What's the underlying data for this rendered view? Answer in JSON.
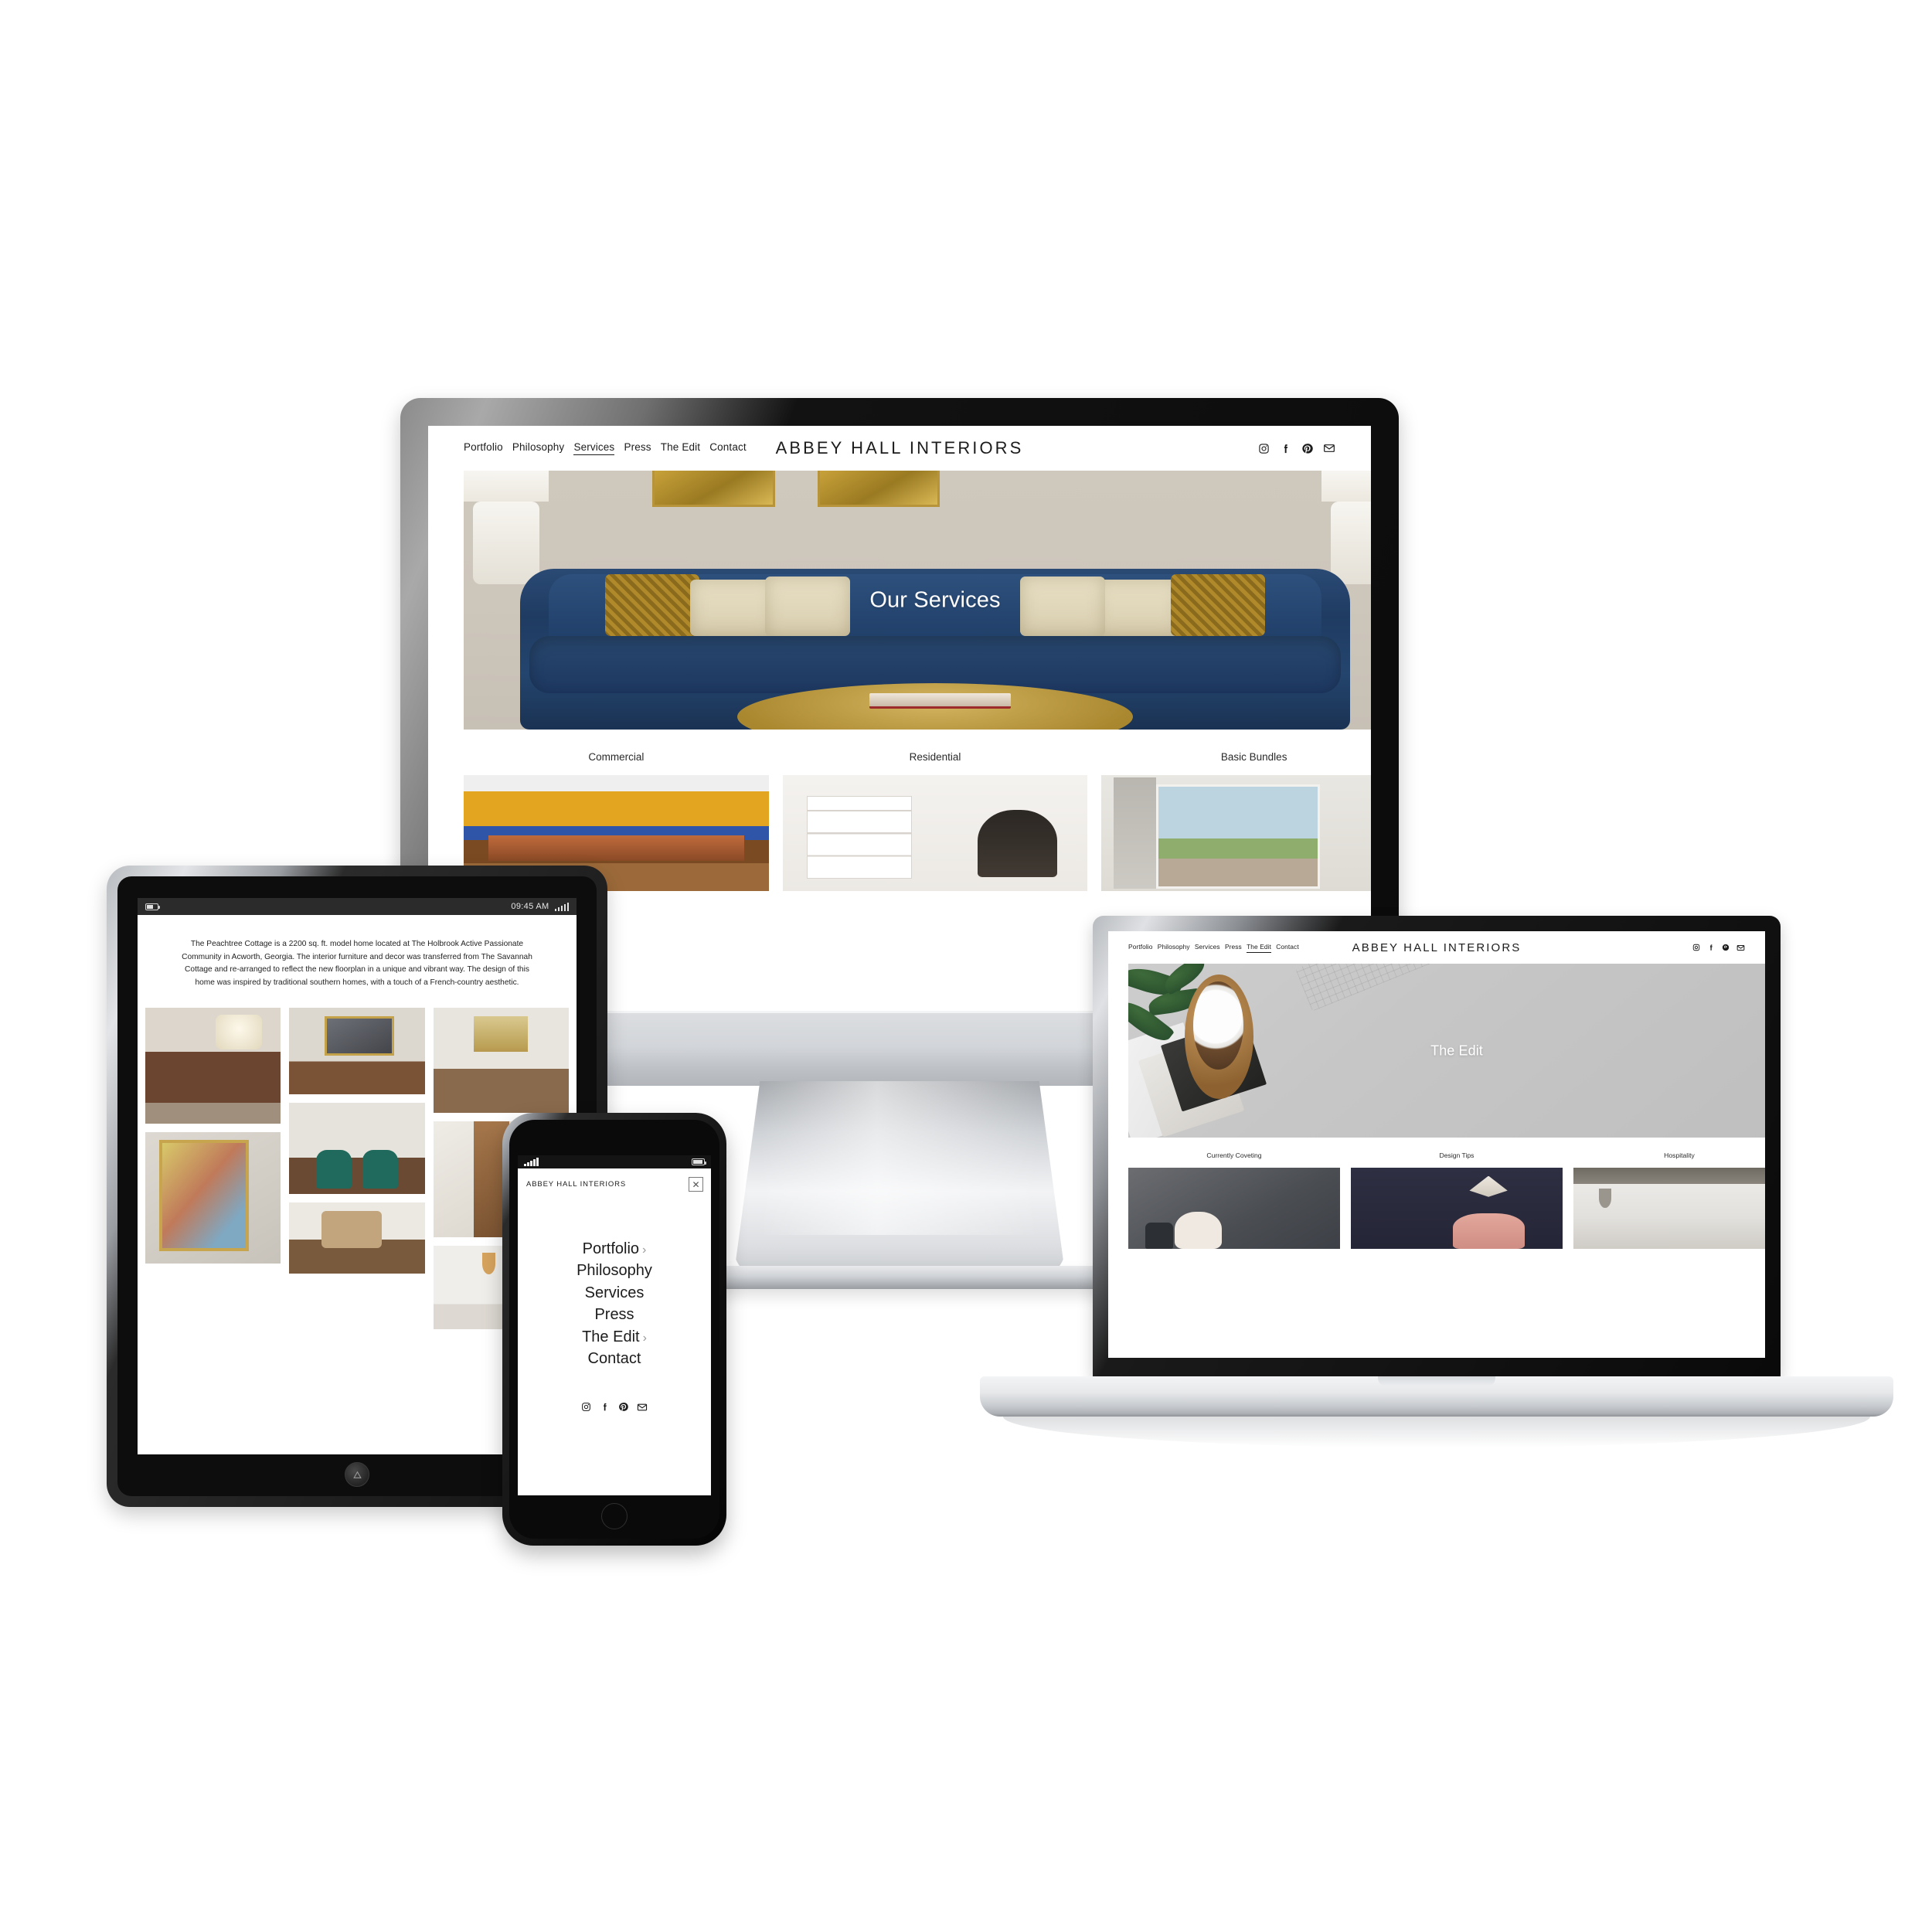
{
  "brand": "ABBEY HALL INTERIORS",
  "nav_items": [
    "Portfolio",
    "Philosophy",
    "Services",
    "Press",
    "The Edit",
    "Contact"
  ],
  "social_icons": [
    "instagram-icon",
    "facebook-icon",
    "pinterest-icon",
    "email-icon"
  ],
  "desktop": {
    "brand": "ABBEY HALL INTERIORS",
    "nav": [
      {
        "label": "Portfolio",
        "active": false
      },
      {
        "label": "Philosophy",
        "active": false
      },
      {
        "label": "Services",
        "active": true
      },
      {
        "label": "Press",
        "active": false
      },
      {
        "label": "The Edit",
        "active": false
      },
      {
        "label": "Contact",
        "active": false
      }
    ],
    "hero_title": "Our Services",
    "categories": [
      {
        "label": "Commercial"
      },
      {
        "label": "Residential"
      },
      {
        "label": "Basic Bundles"
      }
    ]
  },
  "laptop": {
    "brand": "ABBEY HALL INTERIORS",
    "nav": [
      {
        "label": "Portfolio",
        "active": false
      },
      {
        "label": "Philosophy",
        "active": false
      },
      {
        "label": "Services",
        "active": false
      },
      {
        "label": "Press",
        "active": false
      },
      {
        "label": "The Edit",
        "active": true
      },
      {
        "label": "Contact",
        "active": false
      }
    ],
    "hero_title": "The Edit",
    "categories": [
      {
        "label": "Currently Coveting"
      },
      {
        "label": "Design Tips"
      },
      {
        "label": "Hospitality"
      }
    ]
  },
  "tablet": {
    "status": {
      "time": "09:45 AM"
    },
    "intro": "The Peachtree Cottage is a 2200 sq. ft. model home located at The Holbrook Active Passionate Community in Acworth, Georgia. The interior furniture and decor was transferred from The Savannah Cottage and re-arranged to reflect the new floorplan in a unique and vibrant way. The design of this home was inspired by traditional southern homes, with a touch of a French-country aesthetic.",
    "gallery": [
      {
        "caption": "dresser-with-lamp"
      },
      {
        "caption": "horse-art-credenza"
      },
      {
        "caption": "entry-hall-console"
      },
      {
        "caption": "framed-abstract-art"
      },
      {
        "caption": "emerald-chairs-gold-mirrors"
      },
      {
        "caption": "wood-staircase"
      },
      {
        "caption": "kitchen-pendants"
      },
      {
        "caption": "stair-newel-post"
      }
    ]
  },
  "phone": {
    "brand": "ABBEY HALL INTERIORS",
    "close_label": "✕",
    "menu": [
      {
        "label": "Portfolio",
        "chevron": "›"
      },
      {
        "label": "Philosophy",
        "chevron": ""
      },
      {
        "label": "Services",
        "chevron": ""
      },
      {
        "label": "Press",
        "chevron": ""
      },
      {
        "label": "The Edit",
        "chevron": "›"
      },
      {
        "label": "Contact",
        "chevron": ""
      }
    ]
  },
  "colors": {
    "background": "#ffffff",
    "text": "#1c1c1c",
    "hero_overlay_text": "#ffffff",
    "sofa_navy": "#24456e",
    "accent_gold": "#b08a2a",
    "desk_gray": "#c6c6c6"
  }
}
